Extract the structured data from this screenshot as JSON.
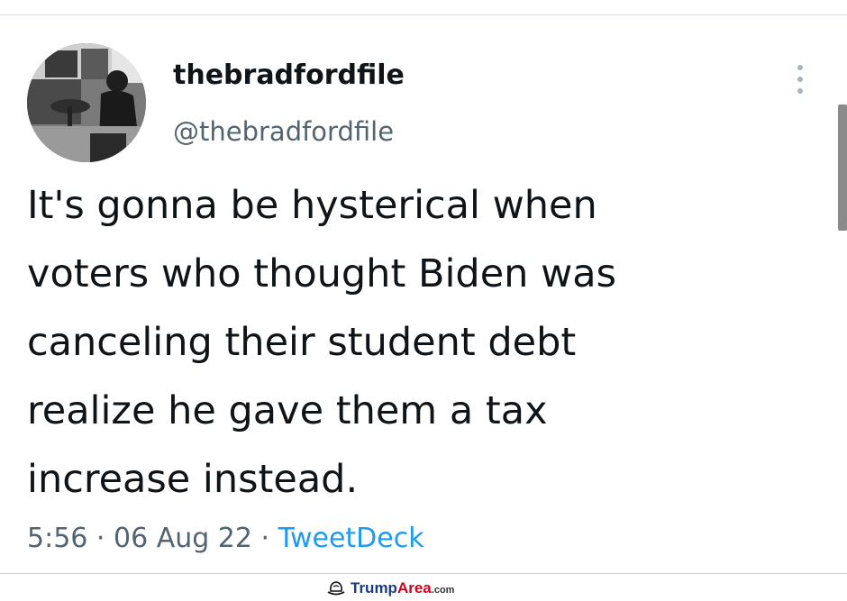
{
  "tweet": {
    "display_name": "thebradfordfile",
    "handle": "@thebradfordfile",
    "text_lines": [
      "It's gonna be hysterical when",
      "voters who thought Biden was",
      "canceling their student debt",
      "realize he gave them a tax",
      "increase instead."
    ],
    "time": "5:56",
    "separator": " · ",
    "date": "06 Aug 22",
    "source": "TweetDeck",
    "more_icon": "more-vertical-icon",
    "avatar_icon": "profile-photo"
  },
  "watermark": {
    "brand_part1": "Trump",
    "brand_part2": "Area",
    "brand_part3": ".com",
    "icon": "hat-icon"
  },
  "colors": {
    "text": "#0f1419",
    "secondary": "#536471",
    "link": "#1d9bf0",
    "watermark_blue": "#1b3a8a",
    "watermark_red": "#d0021b"
  }
}
